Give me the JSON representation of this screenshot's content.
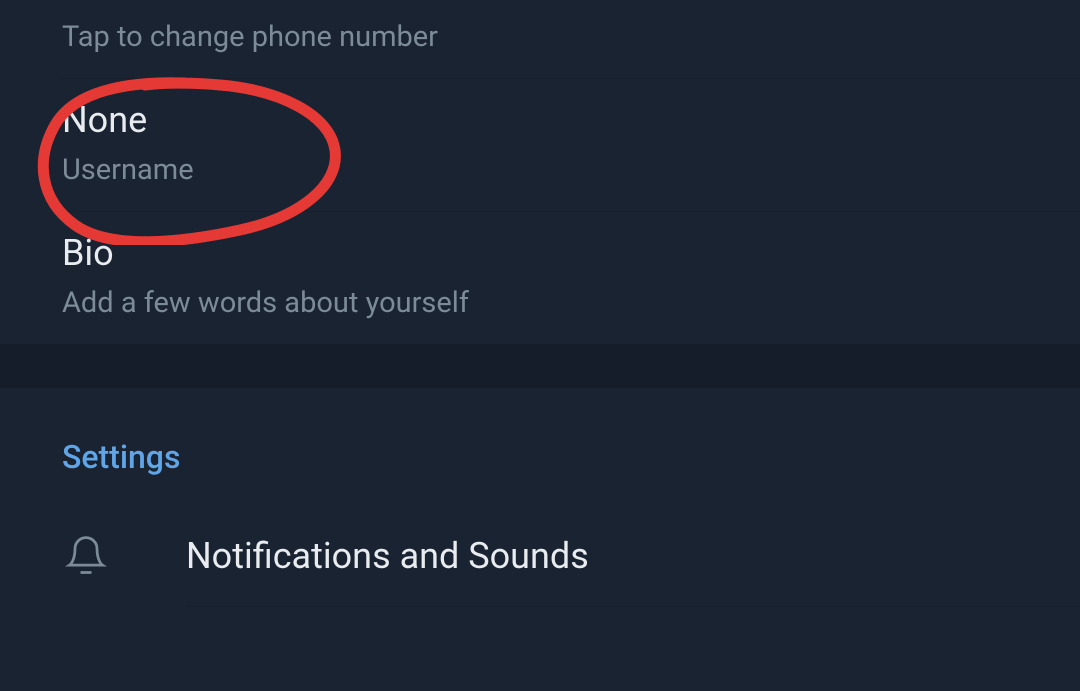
{
  "phone_hint": "Tap to change phone number",
  "username": {
    "value": "None",
    "label": "Username"
  },
  "bio": {
    "value": "Bio",
    "label": "Add a few words about yourself"
  },
  "section_header": "Settings",
  "settings": {
    "notifications": {
      "label": "Notifications and Sounds"
    }
  },
  "annotation_color": "#e53935"
}
